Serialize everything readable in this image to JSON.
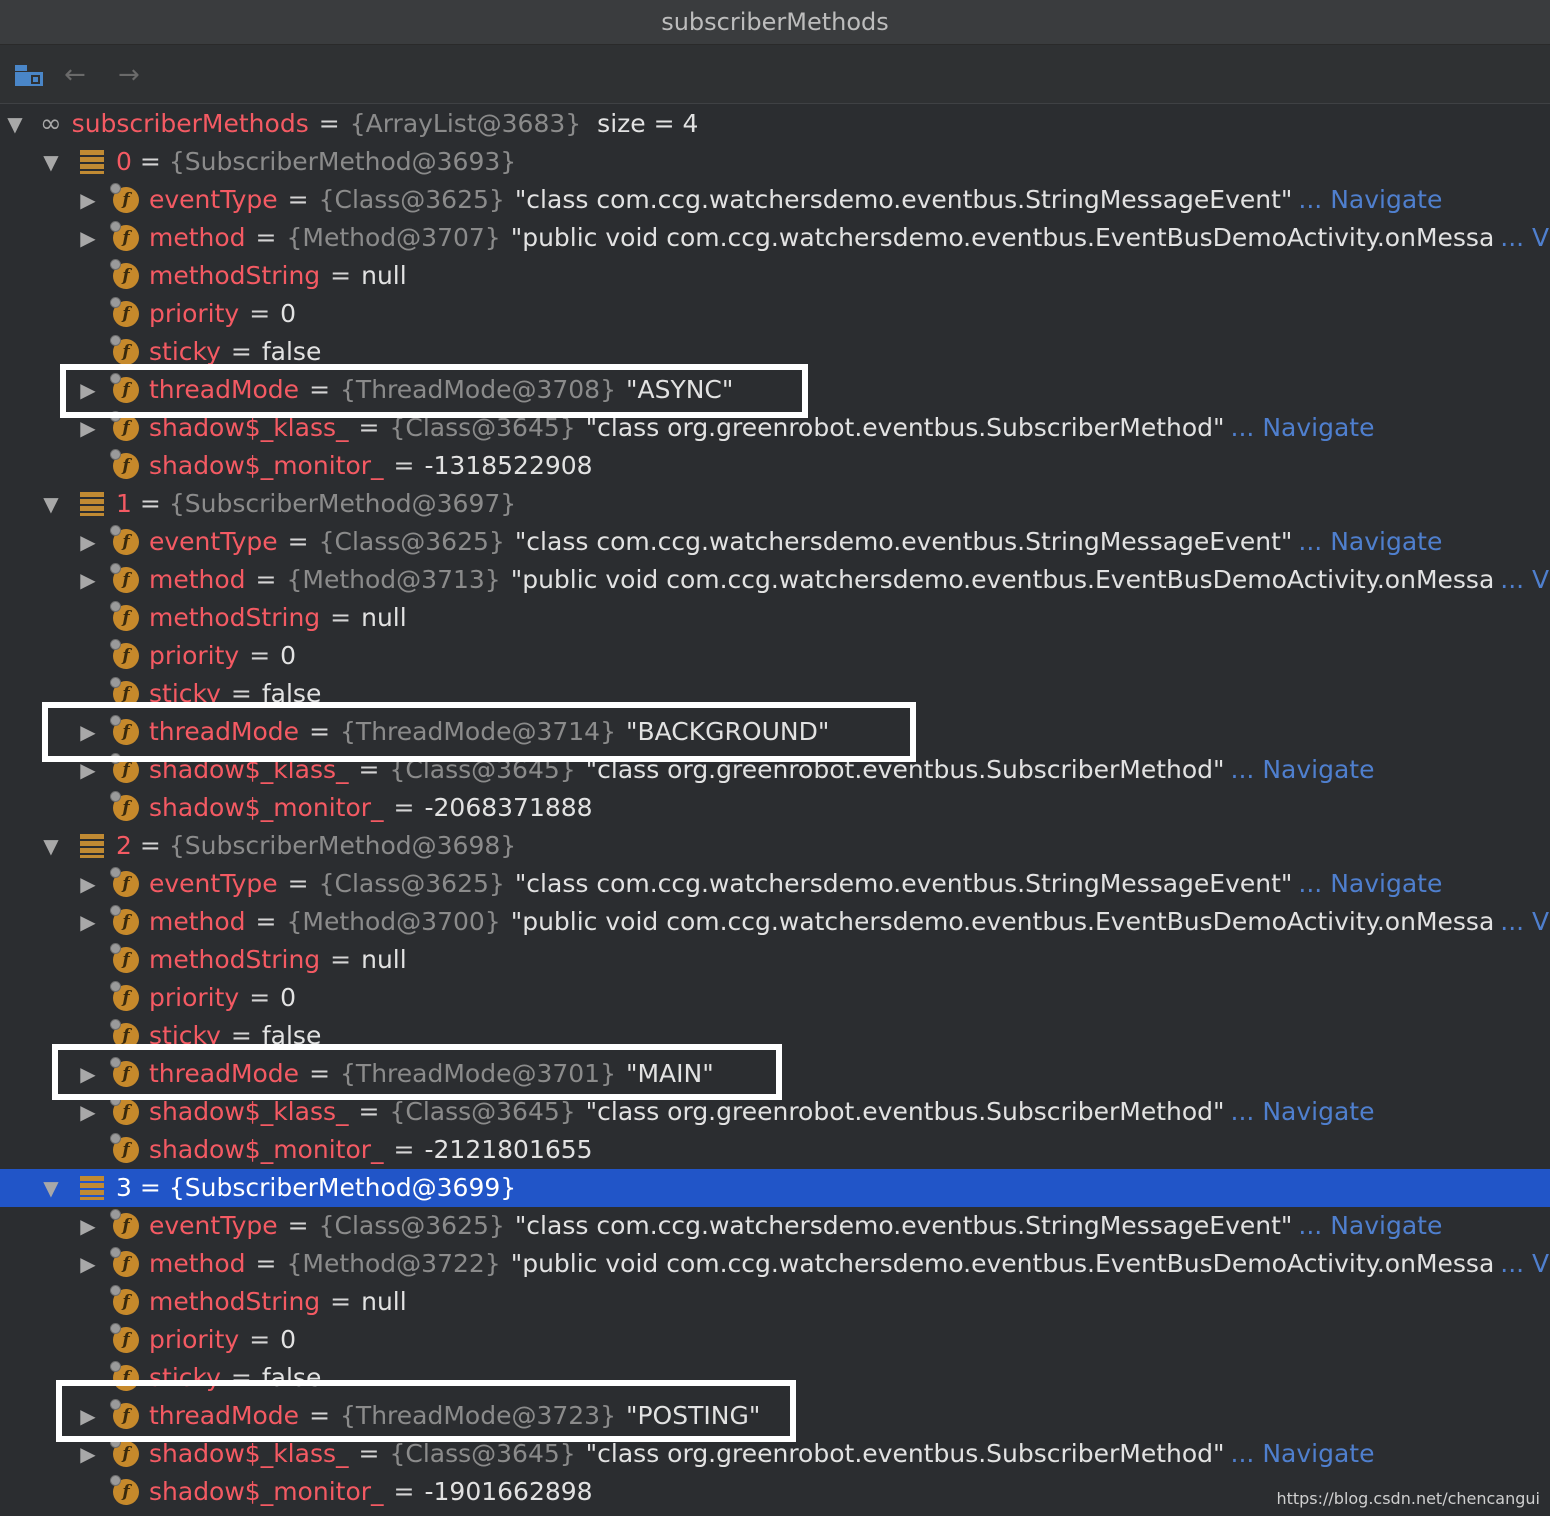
{
  "window": {
    "title": "subscriberMethods"
  },
  "toolbar": {
    "icons": [
      "frames-icon",
      "back-arrow-icon",
      "forward-arrow-icon"
    ],
    "back_glyph": "←",
    "forward_glyph": "→"
  },
  "root": {
    "name": "subscriberMethods",
    "type": "{ArrayList@3683}",
    "size": "size = 4"
  },
  "items": [
    {
      "index": "0",
      "type": "{SubscriberMethod@3693}",
      "fields": {
        "eventType": {
          "name": "eventType",
          "type": "{Class@3625}",
          "value": "\"class com.ccg.watchersdemo.eventbus.StringMessageEvent\"",
          "link": "... Navigate"
        },
        "method": {
          "name": "method",
          "type": "{Method@3707}",
          "value": "\"public void com.ccg.watchersdemo.eventbus.EventBusDemoActivity.onMessa",
          "link": "... View"
        },
        "methodString": {
          "name": "methodString",
          "value": "null"
        },
        "priority": {
          "name": "priority",
          "value": "0"
        },
        "sticky": {
          "name": "sticky",
          "value": "false"
        },
        "threadMode": {
          "name": "threadMode",
          "type": "{ThreadMode@3708}",
          "value": "\"ASYNC\""
        },
        "klass": {
          "name": "shadow$_klass_",
          "type": "{Class@3645}",
          "value": "\"class org.greenrobot.eventbus.SubscriberMethod\"",
          "link": "... Navigate"
        },
        "monitor": {
          "name": "shadow$_monitor_",
          "value": "-1318522908"
        }
      }
    },
    {
      "index": "1",
      "type": "{SubscriberMethod@3697}",
      "fields": {
        "eventType": {
          "name": "eventType",
          "type": "{Class@3625}",
          "value": "\"class com.ccg.watchersdemo.eventbus.StringMessageEvent\"",
          "link": "... Navigate"
        },
        "method": {
          "name": "method",
          "type": "{Method@3713}",
          "value": "\"public void com.ccg.watchersdemo.eventbus.EventBusDemoActivity.onMessa",
          "link": "... View"
        },
        "methodString": {
          "name": "methodString",
          "value": "null"
        },
        "priority": {
          "name": "priority",
          "value": "0"
        },
        "sticky": {
          "name": "sticky",
          "value": "false"
        },
        "threadMode": {
          "name": "threadMode",
          "type": "{ThreadMode@3714}",
          "value": "\"BACKGROUND\""
        },
        "klass": {
          "name": "shadow$_klass_",
          "type": "{Class@3645}",
          "value": "\"class org.greenrobot.eventbus.SubscriberMethod\"",
          "link": "... Navigate"
        },
        "monitor": {
          "name": "shadow$_monitor_",
          "value": "-2068371888"
        }
      }
    },
    {
      "index": "2",
      "type": "{SubscriberMethod@3698}",
      "fields": {
        "eventType": {
          "name": "eventType",
          "type": "{Class@3625}",
          "value": "\"class com.ccg.watchersdemo.eventbus.StringMessageEvent\"",
          "link": "... Navigate"
        },
        "method": {
          "name": "method",
          "type": "{Method@3700}",
          "value": "\"public void com.ccg.watchersdemo.eventbus.EventBusDemoActivity.onMessa",
          "link": "... View"
        },
        "methodString": {
          "name": "methodString",
          "value": "null"
        },
        "priority": {
          "name": "priority",
          "value": "0"
        },
        "sticky": {
          "name": "sticky",
          "value": "false"
        },
        "threadMode": {
          "name": "threadMode",
          "type": "{ThreadMode@3701}",
          "value": "\"MAIN\""
        },
        "klass": {
          "name": "shadow$_klass_",
          "type": "{Class@3645}",
          "value": "\"class org.greenrobot.eventbus.SubscriberMethod\"",
          "link": "... Navigate"
        },
        "monitor": {
          "name": "shadow$_monitor_",
          "value": "-2121801655"
        }
      }
    },
    {
      "index": "3",
      "type": "{SubscriberMethod@3699}",
      "fields": {
        "eventType": {
          "name": "eventType",
          "type": "{Class@3625}",
          "value": "\"class com.ccg.watchersdemo.eventbus.StringMessageEvent\"",
          "link": "... Navigate"
        },
        "method": {
          "name": "method",
          "type": "{Method@3722}",
          "value": "\"public void com.ccg.watchersdemo.eventbus.EventBusDemoActivity.onMessa",
          "link": "... View"
        },
        "methodString": {
          "name": "methodString",
          "value": "null"
        },
        "priority": {
          "name": "priority",
          "value": "0"
        },
        "sticky": {
          "name": "sticky",
          "value": "false"
        },
        "threadMode": {
          "name": "threadMode",
          "type": "{ThreadMode@3723}",
          "value": "\"POSTING\""
        },
        "klass": {
          "name": "shadow$_klass_",
          "type": "{Class@3645}",
          "value": "\"class org.greenrobot.eventbus.SubscriberMethod\"",
          "link": "... Navigate"
        },
        "monitor": {
          "name": "shadow$_monitor_",
          "value": "-1901662898"
        }
      }
    }
  ],
  "selected_index": "3",
  "watermark": "https://blog.csdn.net/chencangui",
  "colors": {
    "field_name": "#f45a63",
    "selection": "#2155c8",
    "link": "#4f7fce",
    "highlight_box": "#ffffff"
  }
}
